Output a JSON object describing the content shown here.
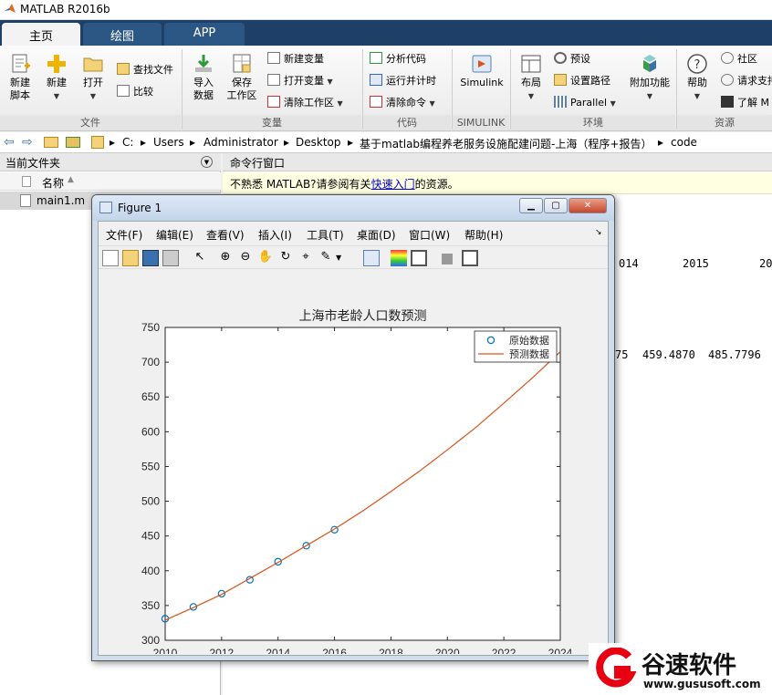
{
  "app": {
    "title": "MATLAB R2016b"
  },
  "tabs": [
    {
      "label": "主页",
      "active": true
    },
    {
      "label": "绘图",
      "active": false
    },
    {
      "label": "APP",
      "active": false
    }
  ],
  "ribbon": {
    "file": {
      "new_script_l1": "新建",
      "new_script_l2": "脚本",
      "new_label": "新建",
      "open_label": "打开",
      "find_files": "查找文件",
      "compare": "比较",
      "group": "文件"
    },
    "variable": {
      "import_l1": "导入",
      "import_l2": "数据",
      "save_l1": "保存",
      "save_l2": "工作区",
      "new_var": "新建变量",
      "open_var": "打开变量",
      "clear_ws": "清除工作区",
      "group": "变量"
    },
    "code": {
      "analyze": "分析代码",
      "run_time": "运行并计时",
      "clear_cmd": "清除命令",
      "group": "代码"
    },
    "simulink": {
      "label": "Simulink",
      "group": "SIMULINK"
    },
    "env": {
      "layout": "布局",
      "prefs": "预设",
      "setpath": "设置路径",
      "parallel": "Parallel",
      "addons": "附加功能",
      "group": "环境"
    },
    "resources": {
      "help": "帮助",
      "community": "社区",
      "request": "请求支持",
      "learn": "了解 M",
      "group": "资源"
    }
  },
  "address": {
    "drive": "C:",
    "parts": [
      "Users",
      "Administrator",
      "Desktop",
      "基于matlab编程养老服务设施配建问题-上海（程序+报告）",
      "code"
    ]
  },
  "left_panel": {
    "title": "当前文件夹",
    "col_name": "名称",
    "files": [
      "main1.m"
    ]
  },
  "cmd_window": {
    "title": "命令行窗口",
    "tip_pre": "不熟悉 MATLAB?请参阅有关",
    "tip_link": "快速入门",
    "tip_post": "的资源。",
    "row1": [
      "014",
      "2015",
      "20"
    ],
    "row2": [
      "75",
      "459.4870",
      "485.7796"
    ]
  },
  "figure": {
    "title": "Figure 1",
    "menu": [
      "文件(F)",
      "编辑(E)",
      "查看(V)",
      "插入(I)",
      "工具(T)",
      "桌面(D)",
      "窗口(W)",
      "帮助(H)"
    ]
  },
  "chart_data": {
    "type": "line",
    "title": "上海市老龄人口数预测",
    "xlabel": "",
    "ylabel": "",
    "xlim": [
      2010,
      2024
    ],
    "ylim": [
      300,
      750
    ],
    "xticks": [
      2010,
      2012,
      2014,
      2016,
      2018,
      2020,
      2022,
      2024
    ],
    "yticks": [
      300,
      350,
      400,
      450,
      500,
      550,
      600,
      650,
      700,
      750
    ],
    "legend_position": "top-right",
    "grid": false,
    "series": [
      {
        "name": "原始数据",
        "kind": "markers",
        "color": "#0072bd",
        "x": [
          2010,
          2011,
          2012,
          2013,
          2014,
          2015,
          2016
        ],
        "y": [
          331,
          348,
          367,
          387,
          413,
          436,
          459
        ]
      },
      {
        "name": "预测数据",
        "kind": "line",
        "color": "#d95319",
        "x": [
          2010,
          2011,
          2012,
          2013,
          2014,
          2015,
          2016,
          2017,
          2018,
          2019,
          2020,
          2021,
          2022,
          2023,
          2024
        ],
        "y": [
          329,
          347,
          366,
          389,
          412,
          436,
          460,
          486,
          514,
          543,
          574,
          606,
          641,
          677,
          715
        ]
      }
    ]
  },
  "watermark": {
    "brand": "谷速软件",
    "url": "www.gususoft.com"
  },
  "colors": {
    "accent": "#1e3f66",
    "orange_line": "#d95319",
    "marker_blue": "#0072bd",
    "watermark_red": "#e60012"
  }
}
